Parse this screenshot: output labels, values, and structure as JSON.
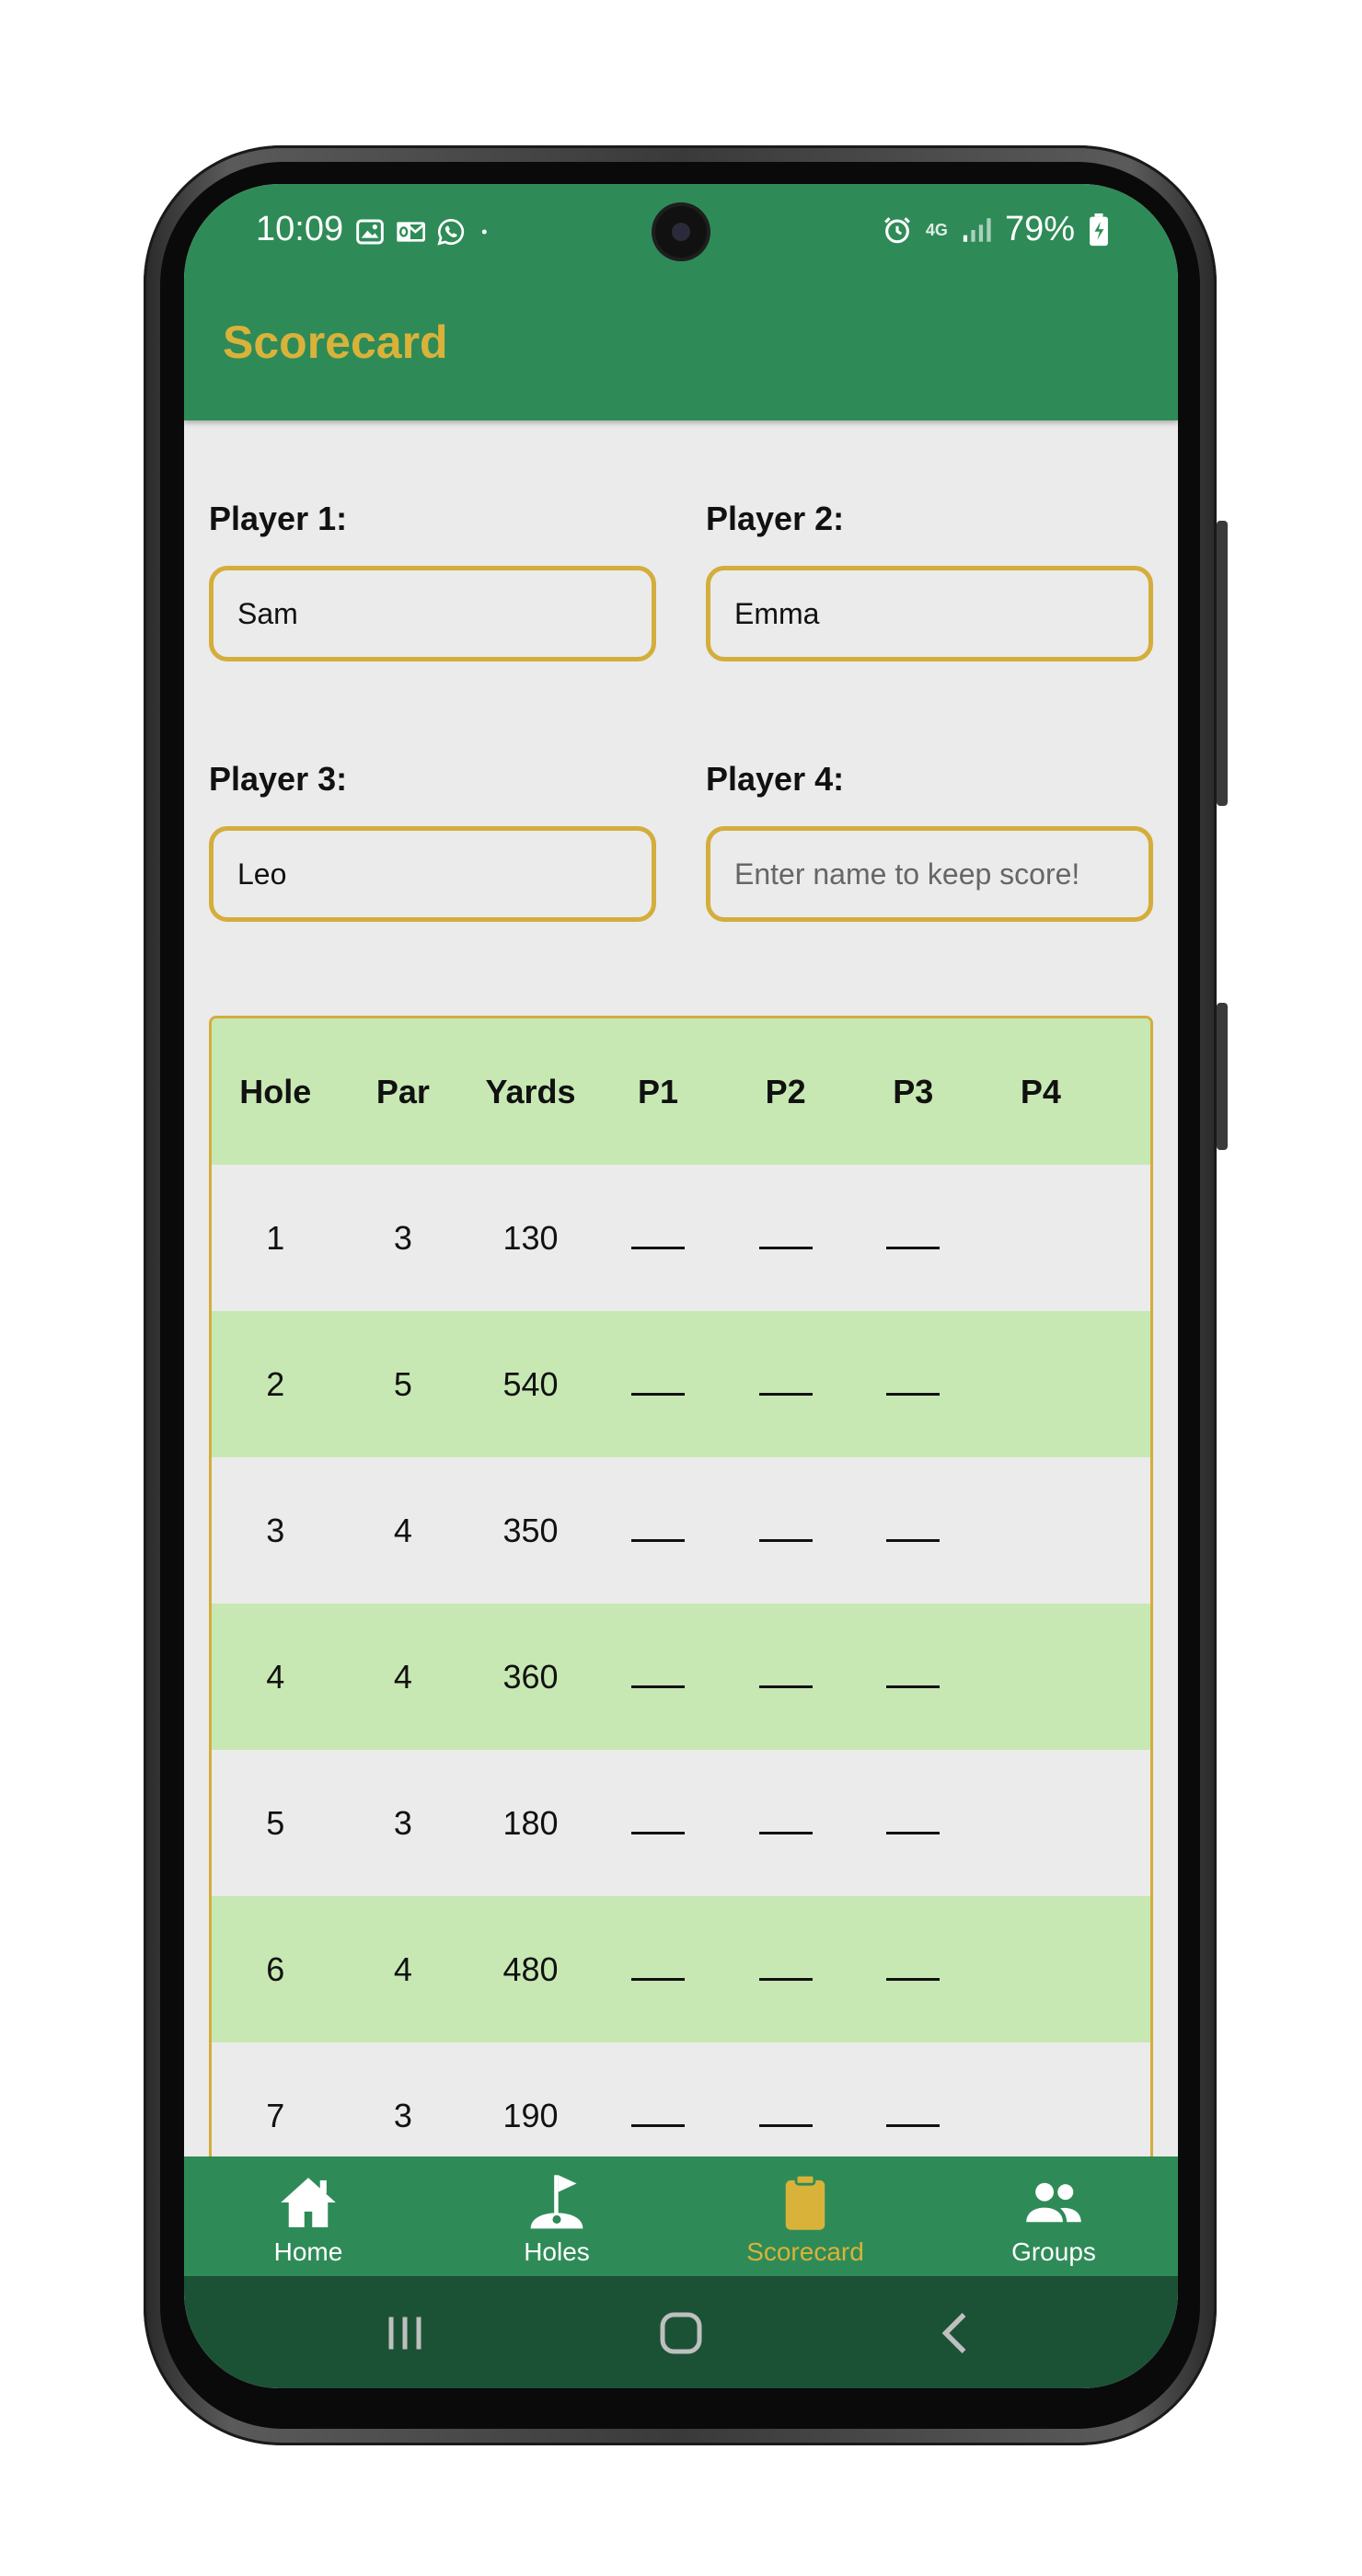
{
  "status_bar": {
    "time": "10:09",
    "battery": "79%",
    "network": "4G"
  },
  "app_bar": {
    "title": "Scorecard"
  },
  "players": [
    {
      "label": "Player 1:",
      "value": "Sam",
      "placeholder": ""
    },
    {
      "label": "Player 2:",
      "value": "Emma",
      "placeholder": ""
    },
    {
      "label": "Player 3:",
      "value": "Leo",
      "placeholder": ""
    },
    {
      "label": "Player 4:",
      "value": "",
      "placeholder": "Enter name to keep score!"
    }
  ],
  "table": {
    "headers": [
      "Hole",
      "Par",
      "Yards",
      "P1",
      "P2",
      "P3",
      "P4"
    ],
    "rows": [
      {
        "hole": "1",
        "par": "3",
        "yards": "130"
      },
      {
        "hole": "2",
        "par": "5",
        "yards": "540"
      },
      {
        "hole": "3",
        "par": "4",
        "yards": "350"
      },
      {
        "hole": "4",
        "par": "4",
        "yards": "360"
      },
      {
        "hole": "5",
        "par": "3",
        "yards": "180"
      },
      {
        "hole": "6",
        "par": "4",
        "yards": "480"
      },
      {
        "hole": "7",
        "par": "3",
        "yards": "190"
      }
    ]
  },
  "bottom_nav": {
    "items": [
      {
        "label": "Home",
        "icon": "home-icon",
        "active": false
      },
      {
        "label": "Holes",
        "icon": "flag-icon",
        "active": false
      },
      {
        "label": "Scorecard",
        "icon": "clipboard-icon",
        "active": true
      },
      {
        "label": "Groups",
        "icon": "groups-icon",
        "active": false
      }
    ]
  },
  "colors": {
    "primary_green": "#2e8b57",
    "accent_gold": "#d9b23a",
    "row_green": "#c7e8b3",
    "background": "#ebebeb",
    "system_nav": "#1b5236"
  }
}
